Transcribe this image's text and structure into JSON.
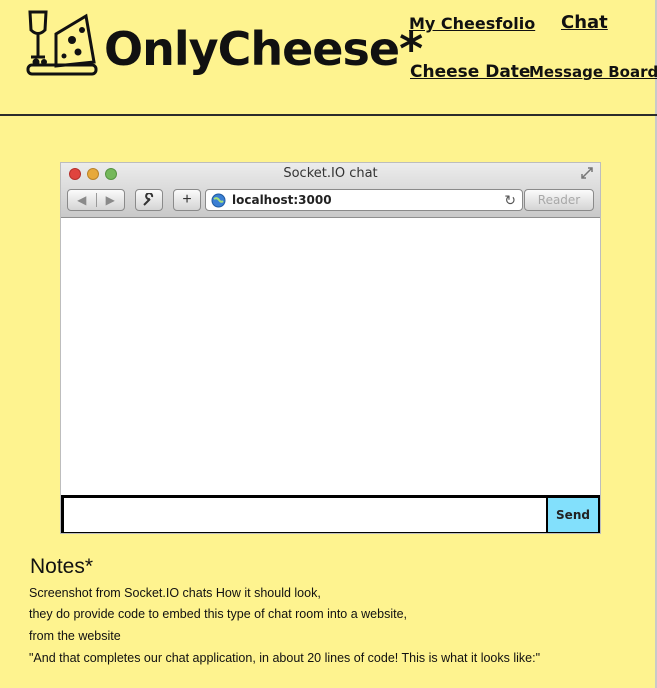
{
  "brand": {
    "name": "OnlyCheese*",
    "logo_icon": "wine-and-cheese-icon"
  },
  "nav": {
    "cheesfolio": "My Cheesfolio",
    "chat": "Chat",
    "cheese_date": "Cheese Date",
    "message_board": "Message Board"
  },
  "browser": {
    "window_title": "Socket.IO chat",
    "url": "localhost:3000",
    "reader_label": "Reader",
    "plus_label": "+",
    "back_label": "◀",
    "forward_label": "▶",
    "send_label": "Send",
    "icons": [
      "back-icon",
      "forward-icon",
      "wrench-icon",
      "plus-icon",
      "globe-icon",
      "reload-icon",
      "expand-icon"
    ]
  },
  "notes": {
    "title": "Notes*",
    "lines": [
      "Screenshot from Socket.IO chats How it should look,",
      "they do provide code to embed this type of chat room into a website,",
      "from the website",
      "\"And that completes our chat application, in about 20 lines of code! This is what it looks like:\""
    ]
  },
  "colors": {
    "background": "#fef38f",
    "send_button": "#82e0fc"
  }
}
